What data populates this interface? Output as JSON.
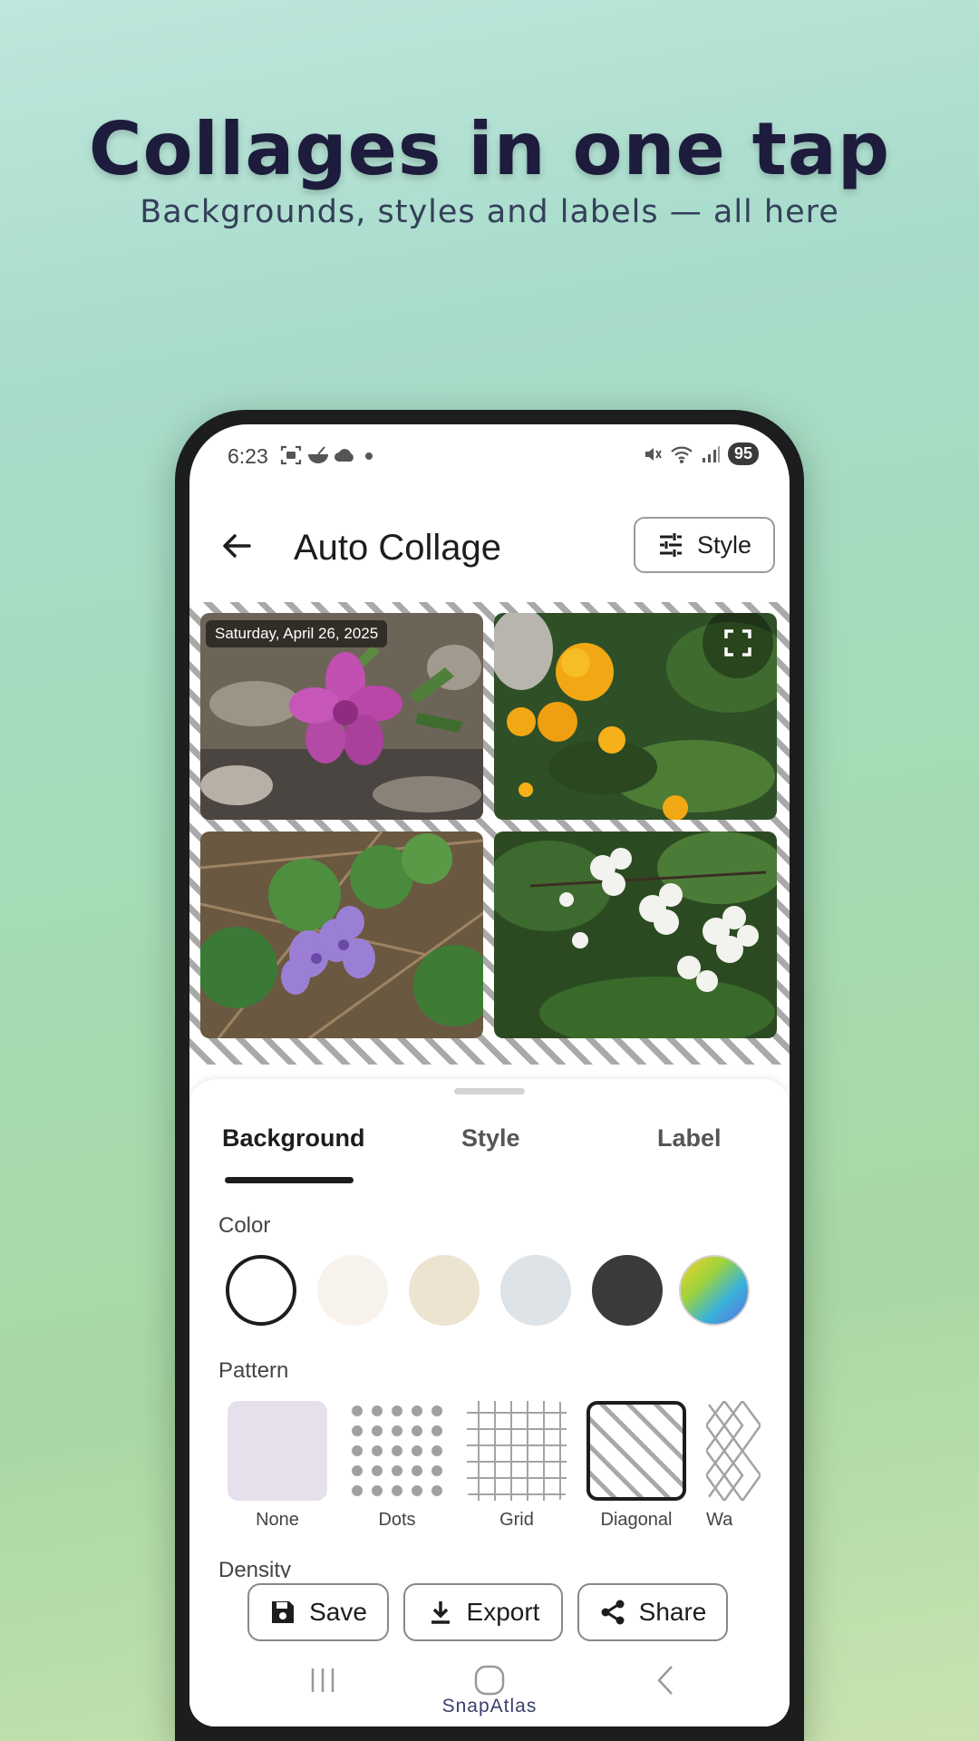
{
  "promo": {
    "title": "Collages in one tap",
    "subtitle": "Backgrounds, styles and labels — all here"
  },
  "statusbar": {
    "time": "6:23",
    "notification_icons": [
      "screenshot-icon",
      "bowl-icon",
      "cloud-icon",
      "dot-icon"
    ],
    "status_icons": [
      "mute-icon",
      "wifi-icon",
      "signal-icon"
    ],
    "battery": "95"
  },
  "appbar": {
    "title": "Auto Collage",
    "style_button": "Style"
  },
  "collage": {
    "date_label": "Saturday, April 26, 2025",
    "background_pattern": "Diagonal",
    "photos": [
      "pink-azalea",
      "yellow-kerria",
      "purple-ground-ivy",
      "white-cherry-blossom"
    ]
  },
  "sheet": {
    "tabs": [
      "Background",
      "Style",
      "Label"
    ],
    "active_tab": "Background",
    "color_label": "Color",
    "colors": [
      "#ffffff",
      "#f7f3ec",
      "#ede3d1",
      "#dde3e6",
      "#3b3b3c",
      "rainbow-gradient"
    ],
    "selected_color": "#ffffff",
    "pattern_label": "Pattern",
    "patterns": [
      "None",
      "Dots",
      "Grid",
      "Diagonal",
      "Wa"
    ],
    "selected_pattern": "Diagonal",
    "density_label": "Density"
  },
  "actions": {
    "save": "Save",
    "export": "Export",
    "share": "Share"
  },
  "brand": "SnapAtlas"
}
